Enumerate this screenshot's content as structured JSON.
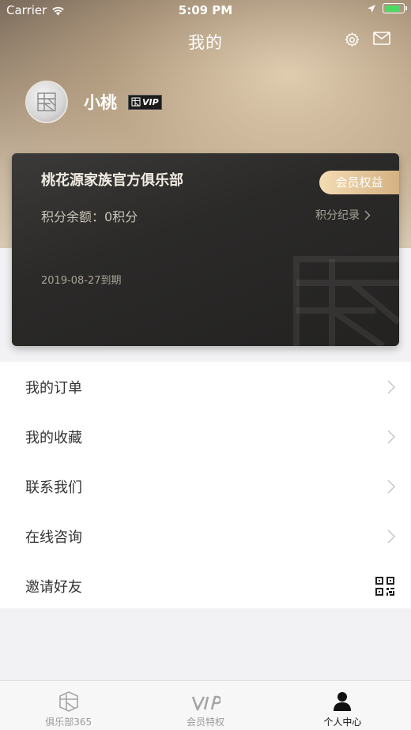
{
  "status_bar": {
    "carrier": "Carrier",
    "time": "5:09 PM",
    "battery_level": 0.85
  },
  "header": {
    "title": "我的"
  },
  "profile": {
    "username": "小桃",
    "badge_text": "VIP"
  },
  "card": {
    "club_name": "桃花源家族官方俱乐部",
    "benefits_button": "会员权益",
    "points_balance": "积分余额：0积分",
    "points_history": "积分纪录",
    "expiry": "2019-08-27到期"
  },
  "menu": {
    "items": [
      {
        "label": "我的订单",
        "icon": "chevron-right-icon"
      },
      {
        "label": "我的收藏",
        "icon": "chevron-right-icon"
      },
      {
        "label": "联系我们",
        "icon": "chevron-right-icon"
      },
      {
        "label": "在线咨询",
        "icon": "chevron-right-icon"
      },
      {
        "label": "邀请好友",
        "icon": "qr-code-icon"
      }
    ]
  },
  "tabbar": {
    "tabs": [
      {
        "label": "俱乐部365",
        "icon": "club-logo-icon",
        "active": false
      },
      {
        "label": "会员特权",
        "icon": "vip-icon",
        "active": false
      },
      {
        "label": "个人中心",
        "icon": "person-icon",
        "active": true
      }
    ]
  },
  "colors": {
    "accent_gold": "#d4b182",
    "card_bg": "#2b2a29",
    "battery_green": "#4cd964"
  }
}
